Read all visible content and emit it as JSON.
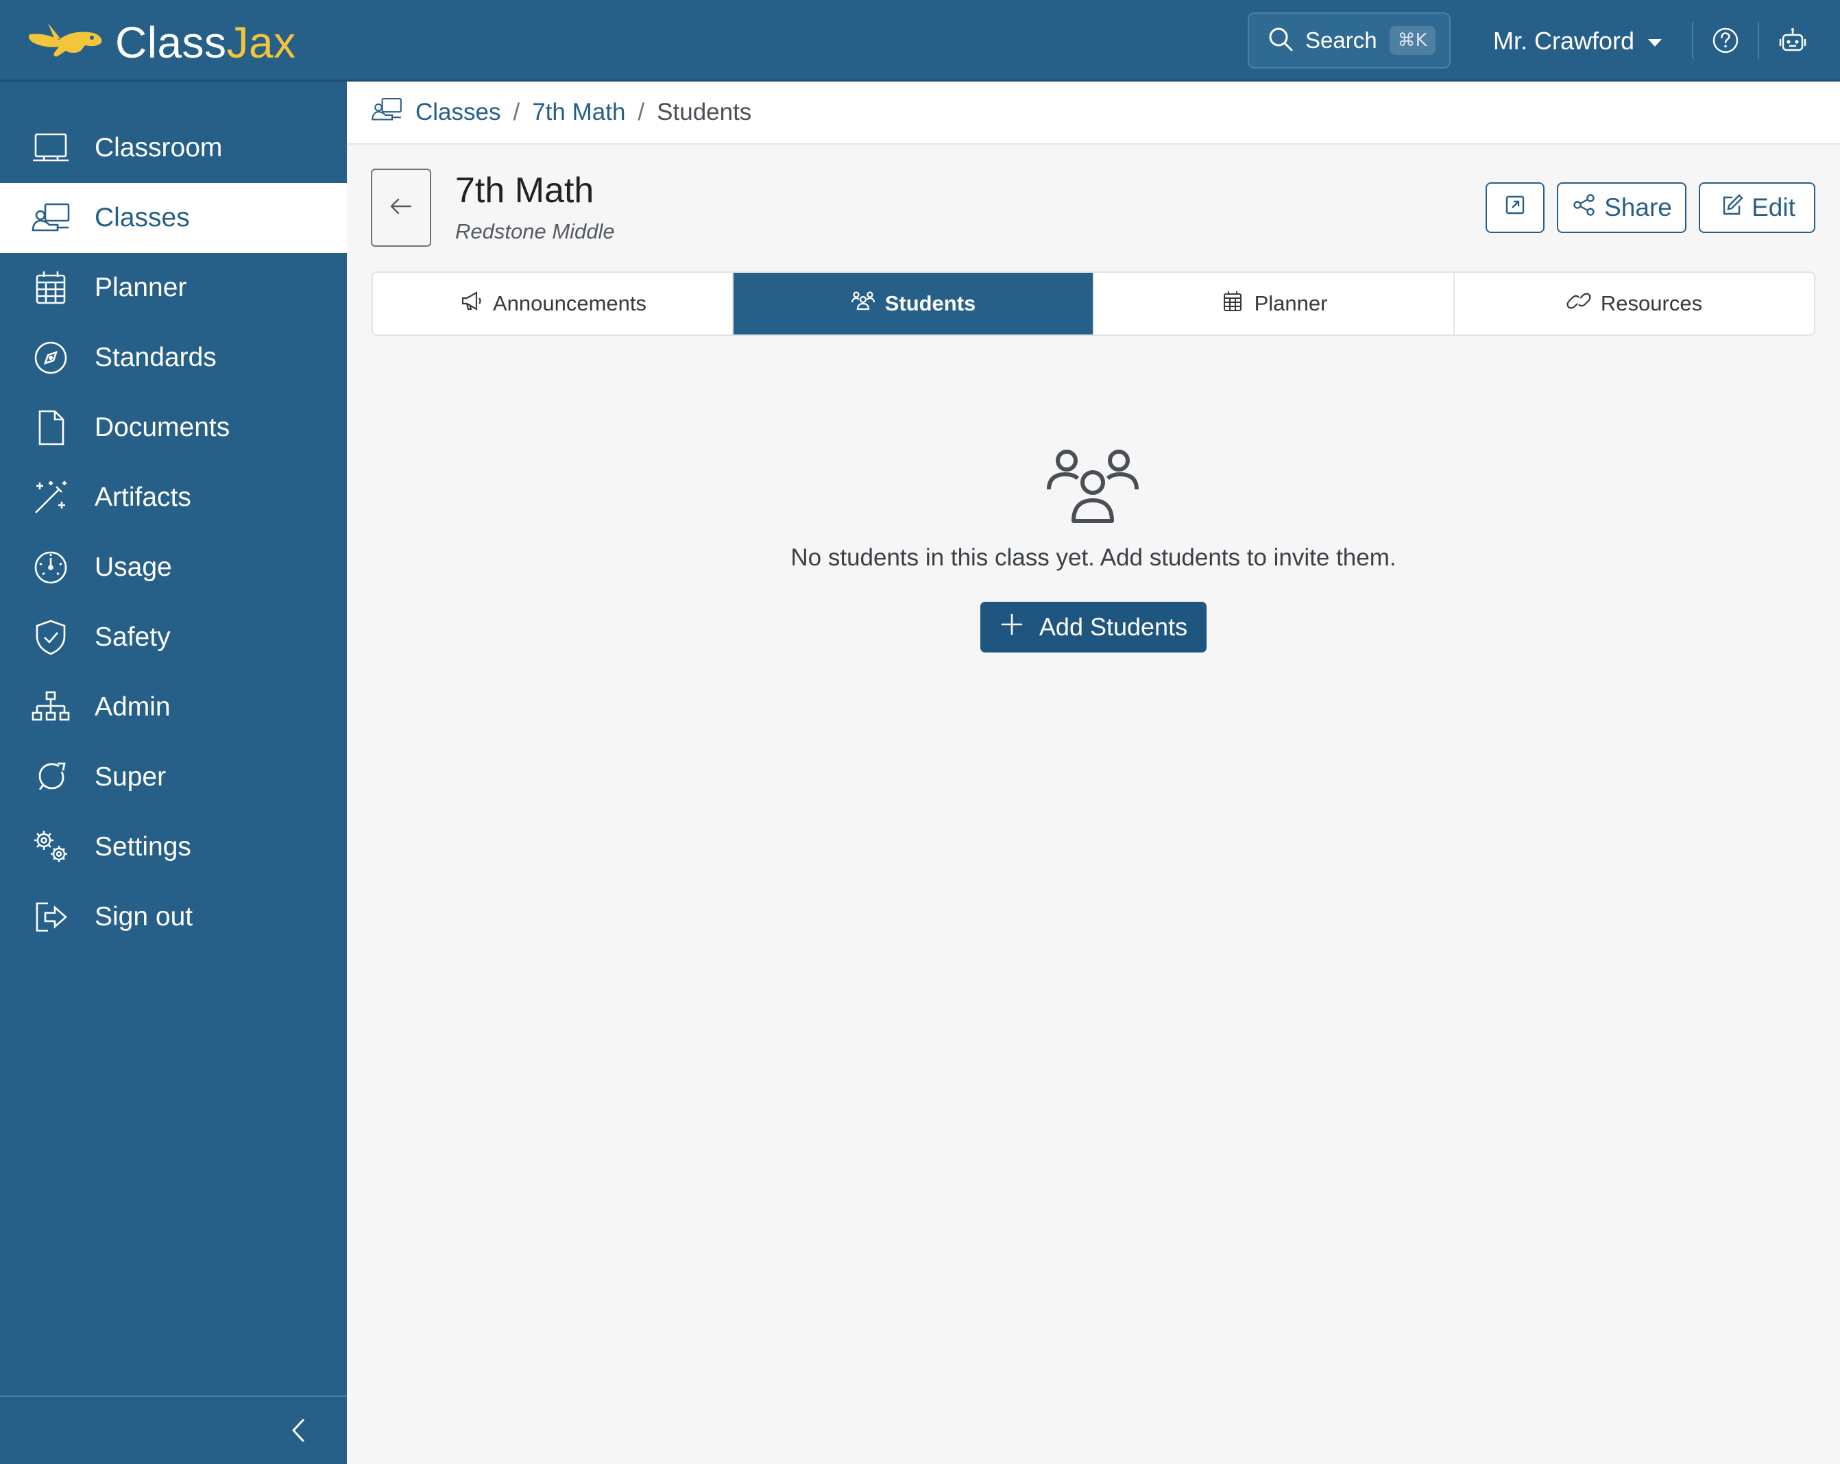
{
  "app": {
    "logo_part1": "Class",
    "logo_part2": "Jax",
    "brand_color": "#265f88",
    "accent_color": "#f3c53b"
  },
  "topbar": {
    "search_label": "Search",
    "search_shortcut": "⌘K",
    "user_name": "Mr. Crawford",
    "icons": [
      "search-icon",
      "help-icon",
      "robot-icon"
    ]
  },
  "sidebar": {
    "items": [
      {
        "label": "Classroom",
        "icon": "classroom-icon",
        "active": false
      },
      {
        "label": "Classes",
        "icon": "classes-icon",
        "active": true
      },
      {
        "label": "Planner",
        "icon": "calendar-icon",
        "active": false
      },
      {
        "label": "Standards",
        "icon": "compass-icon",
        "active": false
      },
      {
        "label": "Documents",
        "icon": "document-icon",
        "active": false
      },
      {
        "label": "Artifacts",
        "icon": "magic-wand-icon",
        "active": false
      },
      {
        "label": "Usage",
        "icon": "speedometer-icon",
        "active": false
      },
      {
        "label": "Safety",
        "icon": "shield-check-icon",
        "active": false
      },
      {
        "label": "Admin",
        "icon": "org-chart-icon",
        "active": false
      },
      {
        "label": "Super",
        "icon": "super-icon",
        "active": false
      },
      {
        "label": "Settings",
        "icon": "gears-icon",
        "active": false
      },
      {
        "label": "Sign out",
        "icon": "sign-out-icon",
        "active": false
      }
    ]
  },
  "breadcrumb": {
    "items": [
      "Classes",
      "7th Math",
      "Students"
    ]
  },
  "header": {
    "title": "7th Math",
    "subtitle": "Redstone Middle",
    "share_label": "Share",
    "edit_label": "Edit"
  },
  "tabs": [
    {
      "label": "Announcements",
      "icon": "megaphone-icon",
      "active": false
    },
    {
      "label": "Students",
      "icon": "people-icon",
      "active": true
    },
    {
      "label": "Planner",
      "icon": "calendar-icon",
      "active": false
    },
    {
      "label": "Resources",
      "icon": "link-icon",
      "active": false
    }
  ],
  "empty_state": {
    "message": "No students in this class yet. Add students to invite them.",
    "button_label": "Add Students"
  }
}
